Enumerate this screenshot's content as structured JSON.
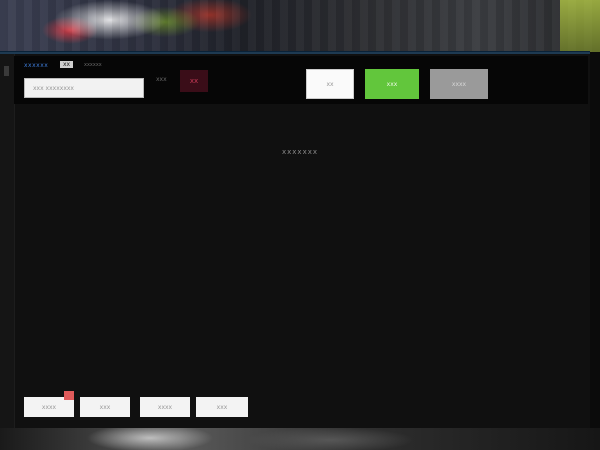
{
  "app": {
    "link_text": "xxxxxx",
    "tag_text": "xx",
    "subtitle": "xxxxxx"
  },
  "search": {
    "placeholder": "xxx xxxxxxxx"
  },
  "status": {
    "label": "xxx",
    "badge": "xx"
  },
  "toolbar": {
    "btn_white_label": "xx",
    "btn_green_label": "xxx",
    "btn_gray_label": "xxxx"
  },
  "main": {
    "message": "xxxxxxx"
  },
  "tabs": [
    {
      "label": "xxxx",
      "has_notification": true
    },
    {
      "label": "xxx"
    },
    {
      "label": "xxxx"
    },
    {
      "label": "xxx"
    }
  ],
  "colors": {
    "accent_green": "#62c63c",
    "link_blue": "#3d7bd6",
    "badge_red": "#c63a56",
    "notification_red": "#e05a5a"
  }
}
